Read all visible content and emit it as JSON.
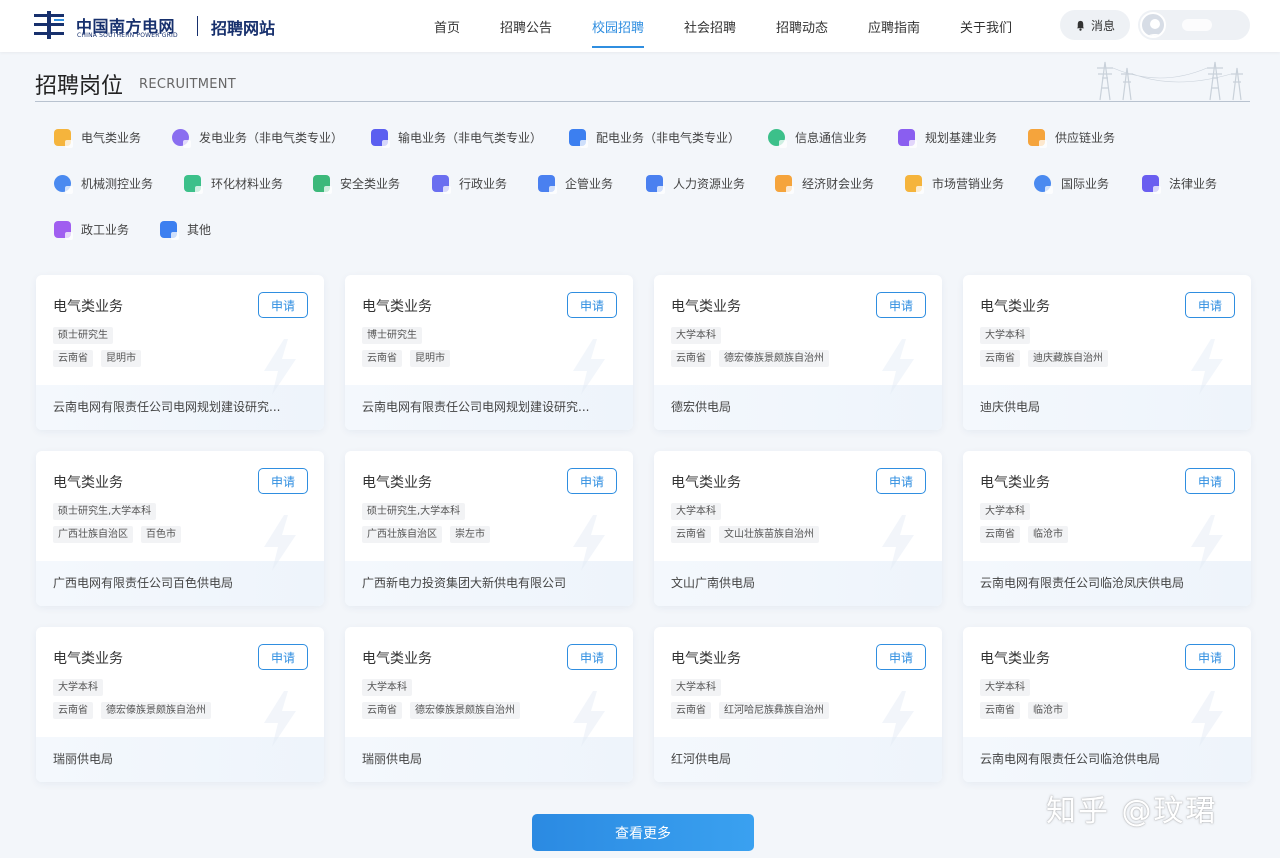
{
  "header": {
    "logo_cn": "中国南方电网",
    "logo_en": "CHINA SOUTHERN POWER GRID",
    "site_name": "招聘网站",
    "nav": [
      "首页",
      "招聘公告",
      "校园招聘",
      "社会招聘",
      "招聘动态",
      "应聘指南",
      "关于我们"
    ],
    "active_nav": "校园招聘",
    "message_label": "消息"
  },
  "section": {
    "title": "招聘岗位",
    "subtitle": "RECRUITMENT"
  },
  "categories": [
    {
      "label": "电气类业务",
      "color": "#f5b43c"
    },
    {
      "label": "发电业务（非电气类专业）",
      "color": "#8a6ef0"
    },
    {
      "label": "输电业务（非电气类专业）",
      "color": "#5b5ff0"
    },
    {
      "label": "配电业务（非电气类专业）",
      "color": "#3c7ff0"
    },
    {
      "label": "信息通信业务",
      "color": "#3cc08a"
    },
    {
      "label": "规划基建业务",
      "color": "#8a5ef0"
    },
    {
      "label": "供应链业务",
      "color": "#f5a43c"
    },
    {
      "label": "机械测控业务",
      "color": "#4a8af0"
    },
    {
      "label": "环化材料业务",
      "color": "#3cc08a"
    },
    {
      "label": "安全类业务",
      "color": "#3cb87a"
    },
    {
      "label": "行政业务",
      "color": "#6a6ef0"
    },
    {
      "label": "企管业务",
      "color": "#4a80f0"
    },
    {
      "label": "人力资源业务",
      "color": "#4a80f0"
    },
    {
      "label": "经济财会业务",
      "color": "#f5a43c"
    },
    {
      "label": "市场营销业务",
      "color": "#f5b43c"
    },
    {
      "label": "国际业务",
      "color": "#4a8af0"
    },
    {
      "label": "法律业务",
      "color": "#6a5ef0"
    },
    {
      "label": "政工业务",
      "color": "#a05ef0"
    },
    {
      "label": "其他",
      "color": "#3c7ff0"
    }
  ],
  "apply_label": "申请",
  "jobs": [
    {
      "title": "电气类业务",
      "education": "硕士研究生",
      "province": "云南省",
      "city": "昆明市",
      "org": "云南电网有限责任公司电网规划建设研究..."
    },
    {
      "title": "电气类业务",
      "education": "博士研究生",
      "province": "云南省",
      "city": "昆明市",
      "org": "云南电网有限责任公司电网规划建设研究..."
    },
    {
      "title": "电气类业务",
      "education": "大学本科",
      "province": "云南省",
      "city": "德宏傣族景颇族自治州",
      "org": "德宏供电局"
    },
    {
      "title": "电气类业务",
      "education": "大学本科",
      "province": "云南省",
      "city": "迪庆藏族自治州",
      "org": "迪庆供电局"
    },
    {
      "title": "电气类业务",
      "education": "硕士研究生,大学本科",
      "province": "广西壮族自治区",
      "city": "百色市",
      "org": "广西电网有限责任公司百色供电局"
    },
    {
      "title": "电气类业务",
      "education": "硕士研究生,大学本科",
      "province": "广西壮族自治区",
      "city": "崇左市",
      "org": "广西新电力投资集团大新供电有限公司"
    },
    {
      "title": "电气类业务",
      "education": "大学本科",
      "province": "云南省",
      "city": "文山壮族苗族自治州",
      "org": "文山广南供电局"
    },
    {
      "title": "电气类业务",
      "education": "大学本科",
      "province": "云南省",
      "city": "临沧市",
      "org": "云南电网有限责任公司临沧凤庆供电局"
    },
    {
      "title": "电气类业务",
      "education": "大学本科",
      "province": "云南省",
      "city": "德宏傣族景颇族自治州",
      "org": "瑞丽供电局"
    },
    {
      "title": "电气类业务",
      "education": "大学本科",
      "province": "云南省",
      "city": "德宏傣族景颇族自治州",
      "org": "瑞丽供电局"
    },
    {
      "title": "电气类业务",
      "education": "大学本科",
      "province": "云南省",
      "city": "红河哈尼族彝族自治州",
      "org": "红河供电局"
    },
    {
      "title": "电气类业务",
      "education": "大学本科",
      "province": "云南省",
      "city": "临沧市",
      "org": "云南电网有限责任公司临沧供电局"
    }
  ],
  "load_more_label": "查看更多",
  "watermark": "知乎 @玟珺",
  "colors": {
    "accent": "#2f8ee0",
    "brand": "#17306d"
  }
}
